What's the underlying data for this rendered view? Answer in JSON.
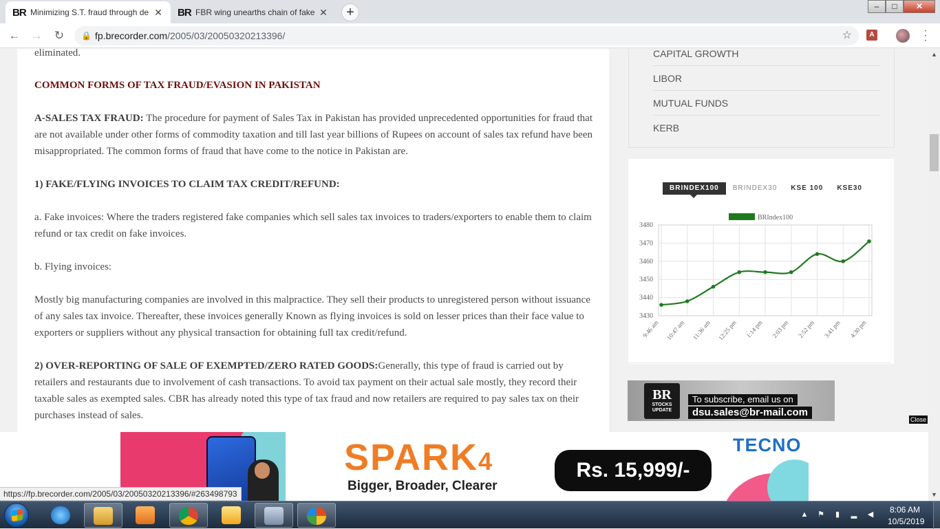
{
  "browser": {
    "tabs": [
      {
        "title": "Minimizing S.T. fraud through de",
        "favicon": "BR",
        "active": true
      },
      {
        "title": "FBR wing unearths chain of fake",
        "favicon": "BR",
        "active": false
      }
    ],
    "new_tab": "+",
    "window_controls": {
      "minimize": "–",
      "maximize": "□",
      "close": "✕"
    },
    "url_host": "fp.brecorder.com",
    "url_path": "/2005/03/20050320213396/",
    "icons": [
      "back-icon",
      "forward-icon",
      "reload-icon",
      "lock-icon",
      "star-icon",
      "pdf-extension-icon",
      "avatar",
      "menu-icon"
    ]
  },
  "article": {
    "para0": "eliminated.",
    "heading1": "COMMON FORMS OF TAX FRAUD/EVASION IN PAKISTAN",
    "para1_lead": "A-SALES TAX FRAUD:",
    "para1_body": " The procedure for payment of Sales Tax in Pakistan has provided unprecedented opportunities for fraud that are not available under other forms of commodity taxation and till last year billions of Rupees on account of sales tax refund have been misappropriated. The common forms of fraud that have come to the notice in Pakistan are.",
    "heading2": "1) FAKE/FLYING INVOICES TO CLAIM TAX CREDIT/REFUND:",
    "para2": "a. Fake invoices: Where the traders registered fake companies which sell sales tax invoices to traders/exporters to enable them to claim refund or tax credit on fake invoices.",
    "para3": "b. Flying invoices:",
    "para4": "Mostly big manufacturing companies are involved in this malpractice. They sell their products to unregistered person without issuance of any sales tax invoice. Thereafter, these invoices generally Known as flying invoices is sold on lesser prices than their face value to exporters or suppliers without any physical transaction for obtaining full tax credit/refund.",
    "para5_lead": "2) OVER-REPORTING OF SALE OF EXEMPTED/ZERO RATED GOODS:",
    "para5_body": "Generally, this type of fraud is carried out by retailers and restaurants due to involvement of cash transactions. To avoid tax payment on their actual sale mostly, they record their taxable sales as exempted sales. CBR has already noted this type of tax fraud and now retailers are required to pay sales tax on their purchases instead of sales."
  },
  "sidebar": {
    "market_links": [
      "CAPITAL GROWTH",
      "LIBOR",
      "MUTUAL FUNDS",
      "KERB"
    ],
    "chart_tabs": [
      "BRINDEX100",
      "BRINDEX30",
      "KSE 100",
      "KSE30"
    ],
    "active_chart_tab": "BRINDEX100",
    "subscribe_line1": "To subscribe, email us on",
    "subscribe_line2": "dsu.sales@br-mail.com",
    "logo_text": "BR",
    "logo_sub1": "STOCKS",
    "logo_sub2": "UPDATE",
    "close_label": "Close"
  },
  "chart_data": {
    "type": "line",
    "title": "",
    "series": [
      {
        "name": "BRIndex100",
        "values": [
          3436,
          3438,
          3446,
          3454,
          3454,
          3454,
          3464,
          3460,
          3471
        ]
      }
    ],
    "categories": [
      "9:46 am",
      "10:47 am",
      "11:36 am",
      "12:25 pm",
      "1:14 pm",
      "2:03 pm",
      "2:52 pm",
      "3:41 pm",
      "4:30 pm"
    ],
    "yticks": [
      3430,
      3440,
      3450,
      3460,
      3470,
      3480
    ],
    "ylim": [
      3430,
      3480
    ],
    "grid": true,
    "legend_position": "top",
    "line_color": "#1f7a1f"
  },
  "ad": {
    "title_main": "SPARK",
    "title_num": "4",
    "tagline": "Bigger, Broader, Clearer",
    "price": "Rs. 15,999/-",
    "brand": "TECNO",
    "colors": {
      "orange": "#f07c24",
      "pink": "#e93a6d",
      "cyan": "#7fd3d9",
      "blue": "#1d6fc9"
    }
  },
  "status_bar_url": "https://fp.brecorder.com/2005/03/20050320213396/#263498793",
  "taskbar": {
    "apps": [
      "start-button",
      "internet-explorer-icon",
      "file-explorer-icon",
      "media-player-icon",
      "chrome-icon",
      "outlook-icon",
      "calculator-icon",
      "paint-icon"
    ],
    "time": "8:06 AM",
    "date": "10/5/2019"
  }
}
